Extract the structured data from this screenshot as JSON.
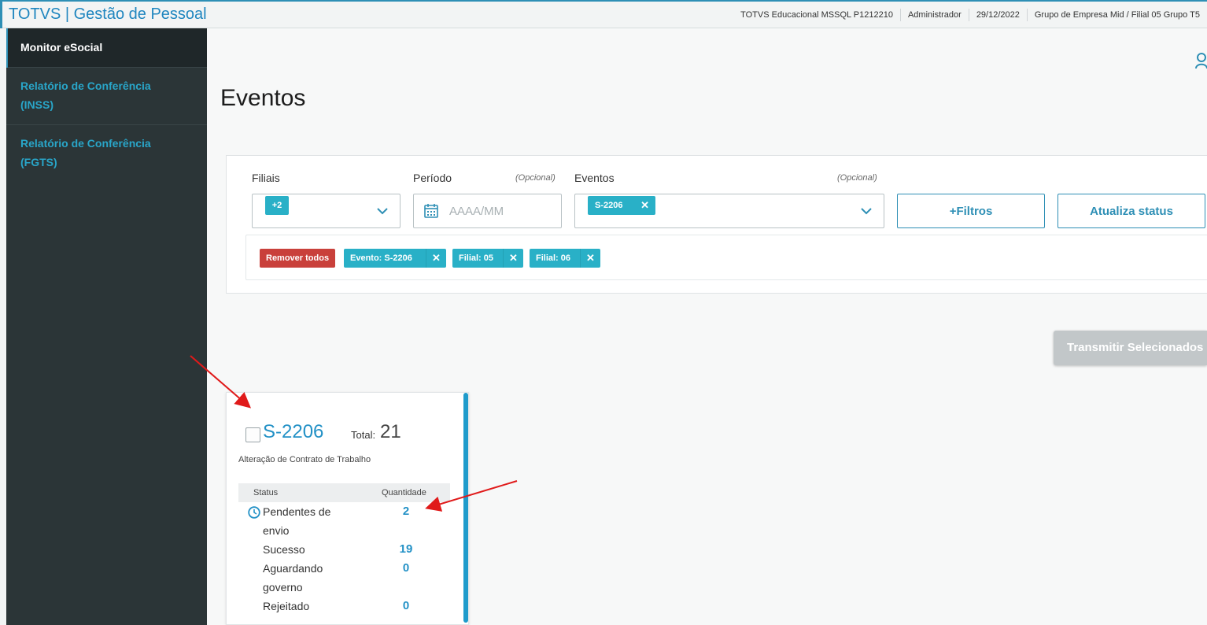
{
  "topbar": {
    "brand": "TOTVS | Gestão de Pessoal",
    "environment": "TOTVS Educacional MSSQL P1212210",
    "user": "Administrador",
    "date": "29/12/2022",
    "company": "Grupo de Empresa Mid / Filial 05 Grupo T5"
  },
  "sidebar": {
    "items": [
      {
        "line1": "Monitor eSocial",
        "line2": ""
      },
      {
        "line1": "Relatório de Conferência",
        "line2": "(INSS)"
      },
      {
        "line1": "Relatório de Conferência",
        "line2": "(FGTS)"
      }
    ]
  },
  "main": {
    "title": "Eventos",
    "filters": {
      "filiais_label": "Filiais",
      "filiais_chip": "+2",
      "periodo_label": "Período",
      "periodo_optional": "(Opcional)",
      "periodo_placeholder": "AAAA/MM",
      "eventos_label": "Eventos",
      "eventos_optional": "(Opcional)",
      "eventos_chip": "S-2206",
      "filtros_button": "+Filtros",
      "atualiza_button": "Atualiza status"
    },
    "tags": {
      "remove_all": "Remover todos",
      "items": [
        "Evento: S-2206",
        "Filial: 05",
        "Filial: 06"
      ]
    },
    "transmit_button": "Transmitir Selecionados",
    "card": {
      "code": "S-2206",
      "total_label": "Total:",
      "total_value": "21",
      "description": "Alteração de Contrato de Trabalho",
      "col_status": "Status",
      "col_quantity": "Quantidade",
      "rows": [
        {
          "line1": "Pendentes de",
          "line2": "envio",
          "qty": "2"
        },
        {
          "line1": "Sucesso",
          "line2": "",
          "qty": "19"
        },
        {
          "line1": "Aguardando",
          "line2": "governo",
          "qty": "0"
        },
        {
          "line1": "Rejeitado",
          "line2": "",
          "qty": "0"
        }
      ]
    }
  },
  "colors": {
    "accent": "#2e8fb5",
    "chip": "#29b0c7",
    "danger": "#c9403b",
    "sidebar": "#2b3537",
    "annotation": "#e01a1a"
  }
}
